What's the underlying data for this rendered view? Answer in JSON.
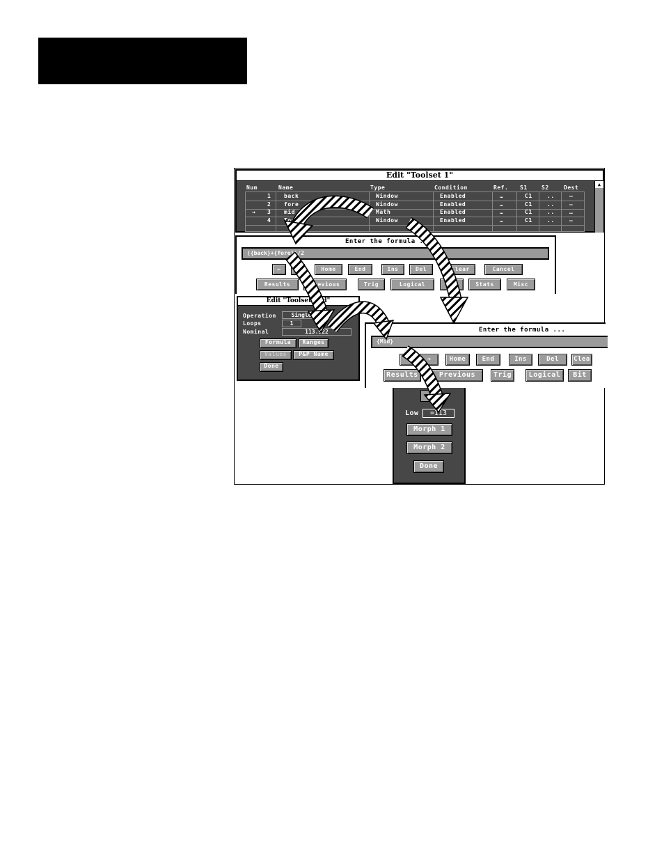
{
  "toolset_window": {
    "title": "Edit \"Toolset 1\"",
    "columns": [
      "Num",
      "Name",
      "Type",
      "Condition",
      "Ref.",
      "S1",
      "S2",
      "Dest"
    ],
    "rows": [
      {
        "marker": "",
        "num": "1",
        "name": "back",
        "type": "Window",
        "condition": "Enabled",
        "ref": "…",
        "s1": "C1",
        "s2": "..",
        "dest": "—"
      },
      {
        "marker": "",
        "num": "2",
        "name": "fore",
        "type": "Window",
        "condition": "Enabled",
        "ref": "…",
        "s1": "C1",
        "s2": "..",
        "dest": "—"
      },
      {
        "marker": "→",
        "num": "3",
        "name": "mid",
        "type": "Math",
        "condition": "Enabled",
        "ref": "…",
        "s1": "C1",
        "s2": "..",
        "dest": "…"
      },
      {
        "marker": "",
        "num": "4",
        "name": "Tool 4",
        "type": "Window",
        "condition": "Enabled",
        "ref": "…",
        "s1": "C1",
        "s2": "..",
        "dest": "—"
      }
    ]
  },
  "formula_window_1": {
    "title": "Enter the formula ...",
    "value": "({back}+{fore})/2",
    "row1": [
      "←",
      "→",
      "Home",
      "End",
      "Ins",
      "Del",
      "Clear",
      "Cancel"
    ],
    "row2": [
      "Results",
      "Previous",
      "Trig",
      "Logical",
      "Bit",
      "Stats",
      "Misc"
    ]
  },
  "mid_window": {
    "title": "Edit \"Toolset mid\"",
    "operation_label": "Operation",
    "operation_value": "Single",
    "loops_label": "Loops",
    "loops_value": "1",
    "nominal_label": "Nominal",
    "nominal_value": "113.922",
    "buttons": [
      "Formula",
      "Ranges",
      "Values",
      "P&P Name",
      "Done"
    ]
  },
  "formula_window_2": {
    "title": "Enter the formula ...",
    "value": "{Mid}",
    "row1": [
      "←",
      "→",
      "Home",
      "End",
      "Ins",
      "Del",
      "Clea"
    ],
    "row2": [
      "Results",
      "Previous",
      "Trig",
      "Logical",
      "Bit"
    ]
  },
  "morph_panel": {
    "low_label": "Low",
    "low_value": "=113",
    "buttons": [
      "Morph 1",
      "Morph 2",
      "Done"
    ]
  }
}
